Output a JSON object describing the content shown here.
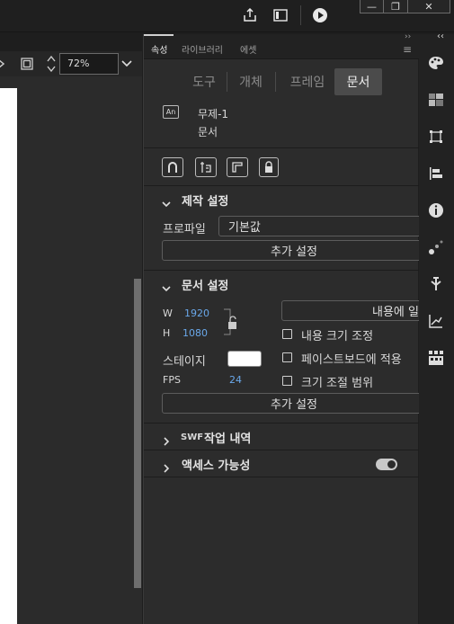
{
  "window": {
    "minimize_label": "—",
    "restore_label": "❐",
    "close_label": "✕"
  },
  "stage": {
    "zoom_value": "72%"
  },
  "panel": {
    "tabs": [
      "속성",
      "라이브러리",
      "에셋"
    ],
    "menu_glyph": "≡",
    "collapse_glyph": "››",
    "subtabs": [
      "도구",
      "개체",
      "프레임",
      "문서"
    ],
    "document": {
      "badge": "An",
      "name": "무제-1",
      "type": "문서"
    },
    "publish_section": {
      "title": "제작 설정",
      "profile_label": "프로파일",
      "profile_value": "기본값",
      "more_button": "추가 설정"
    },
    "doc_settings": {
      "title": "문서 설정",
      "w_label": "W",
      "w_value": "1920",
      "h_label": "H",
      "h_value": "1080",
      "stage_label": "스테이지",
      "fps_label": "FPS",
      "fps_value": "24",
      "match_contents_button": "내용에 일",
      "scale_content_label": "내용 크기 조정",
      "apply_pasteboard_label": "페이스트보드에 적용",
      "scale_spans_label": "크기 조절 범위",
      "more_button": "추가 설정"
    },
    "swf_history": {
      "swf": "SWF",
      "title": "작업 내역"
    },
    "accessibility": {
      "title": "액세스 가능성"
    }
  },
  "right_strip": {
    "collapse_glyph": "‹‹"
  },
  "colors": {
    "accent_blue": "#6aa8ea",
    "panel_bg": "#2c2c2c",
    "stage_color": "#ffffff"
  }
}
